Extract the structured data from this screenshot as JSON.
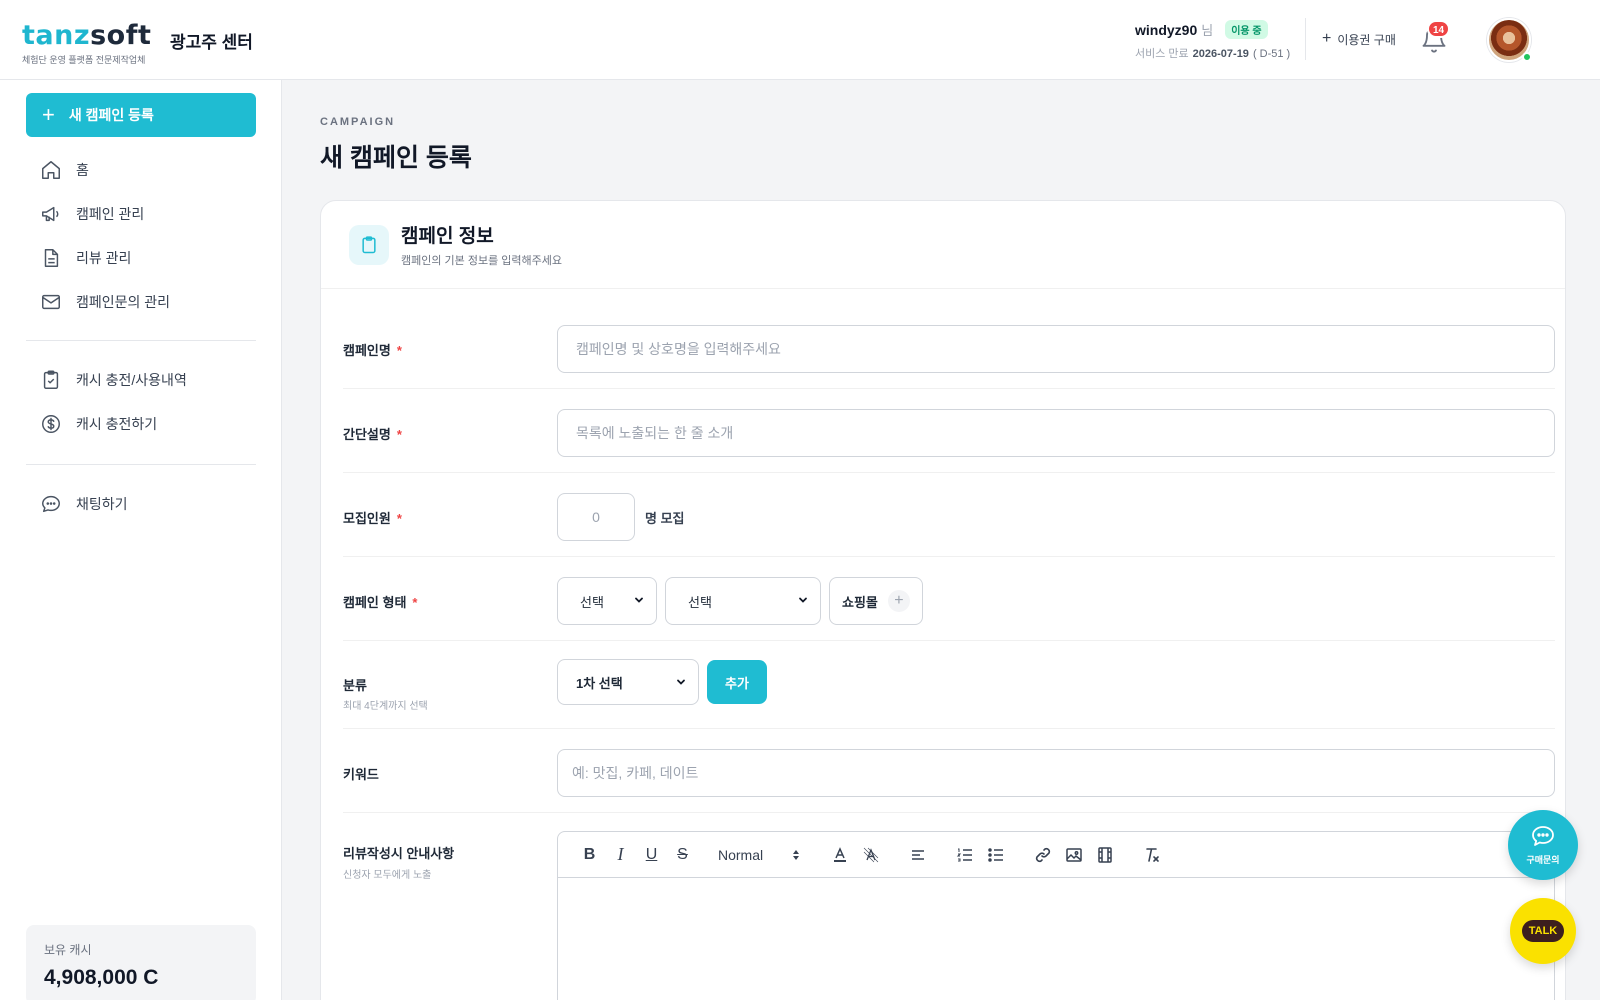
{
  "brand": {
    "logo_tanz": "tanz",
    "logo_soft": "soft",
    "tagline": "체험단 운영 플랫폼 전문제작업체",
    "center_name": "광고주 센터"
  },
  "user": {
    "id": "windyz90",
    "suffix": "님",
    "status": "이용 중",
    "service_label": "서비스 만료",
    "service_date": "2026-07-19",
    "service_dday": "( D-51 )",
    "buy_label": "이용권 구매",
    "notification_count": "14"
  },
  "sidebar": {
    "new_campaign": "새 캠페인 등록",
    "items": [
      {
        "label": "홈",
        "icon": "home-icon"
      },
      {
        "label": "캠페인 관리",
        "icon": "megaphone-icon"
      },
      {
        "label": "리뷰 관리",
        "icon": "document-icon"
      },
      {
        "label": "캠페인문의 관리",
        "icon": "mail-icon"
      }
    ],
    "items2": [
      {
        "label": "캐시 충전/사용내역",
        "icon": "clipboard-check-icon"
      },
      {
        "label": "캐시 충전하기",
        "icon": "dollar-circle-icon"
      }
    ],
    "items3": [
      {
        "label": "채팅하기",
        "icon": "chat-icon"
      }
    ],
    "cash_label": "보유 캐시",
    "cash_value": "4,908,000 C"
  },
  "page": {
    "eyebrow": "CAMPAIGN",
    "title": "새 캠페인 등록"
  },
  "card": {
    "title": "캠페인 정보",
    "subtitle": "캠페인의 기본 정보를 입력해주세요"
  },
  "form": {
    "name_label": "캠페인명",
    "name_placeholder": "캠페인명 및 상호명을 입력해주세요",
    "desc_label": "간단설명",
    "desc_placeholder": "목록에 노출되는 한 줄 소개",
    "recruit_label": "모집인원",
    "recruit_value": "0",
    "recruit_suffix": "명 모집",
    "type_label": "캠페인 형태",
    "type_select1": "선택",
    "type_select2": "선택",
    "type_chip": "쇼핑몰",
    "category_label": "분류",
    "category_hint": "최대 4단계까지 선택",
    "category_select": "1차 선택",
    "category_add": "추가",
    "keyword_label": "키워드",
    "keyword_placeholder": "예: 맛집, 카페, 데이트",
    "guide_label": "리뷰작성시 안내사항",
    "guide_hint": "신청자 모두에게 노출",
    "required_mark": "*",
    "editor_size": "Normal"
  },
  "floating": {
    "chat_label": "구매문의",
    "talk_label": "TALK"
  },
  "colors": {
    "accent": "#1fbcd2",
    "badge": "#ef4444",
    "kakao": "#fae100"
  }
}
